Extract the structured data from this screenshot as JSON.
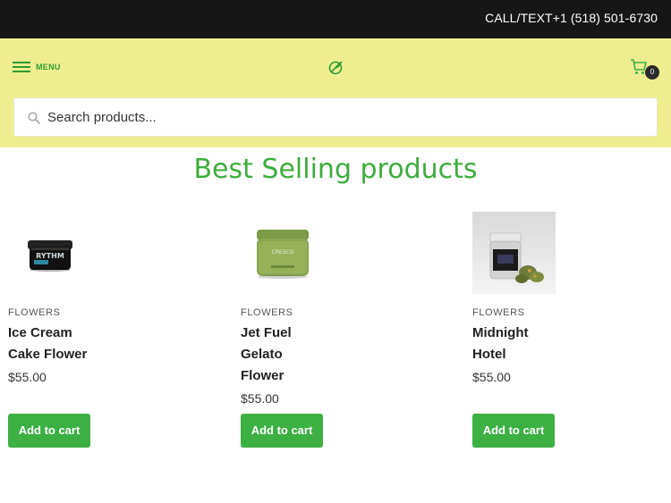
{
  "topbar": {
    "phone_text": "CALL/TEXT+1 (518) 501-6730"
  },
  "header": {
    "menu_label": "MENU",
    "cart_count": "0",
    "search_placeholder": "Search products..."
  },
  "section": {
    "title": "Best Selling products"
  },
  "products": [
    {
      "category": "FLOWERS",
      "name_lines": [
        "Ice Cream",
        "Cake Flower"
      ],
      "price": "$55.00",
      "button": "Add to cart",
      "image": "rythm-jar-black"
    },
    {
      "category": "FLOWERS",
      "name_lines": [
        "Jet Fuel",
        "Gelato",
        "Flower"
      ],
      "price": "$55.00",
      "button": "Add to cart",
      "image": "cresco-jar-green"
    },
    {
      "category": "FLOWERS",
      "name_lines": [
        "Midnight",
        "Hotel"
      ],
      "price": "$55.00",
      "button": "Add to cart",
      "image": "clear-jar-with-buds"
    }
  ],
  "colors": {
    "topbar_bg": "#161616",
    "header_bg": "#eeee90",
    "accent_green": "#3cb043",
    "title_green": "#3dad3d"
  }
}
